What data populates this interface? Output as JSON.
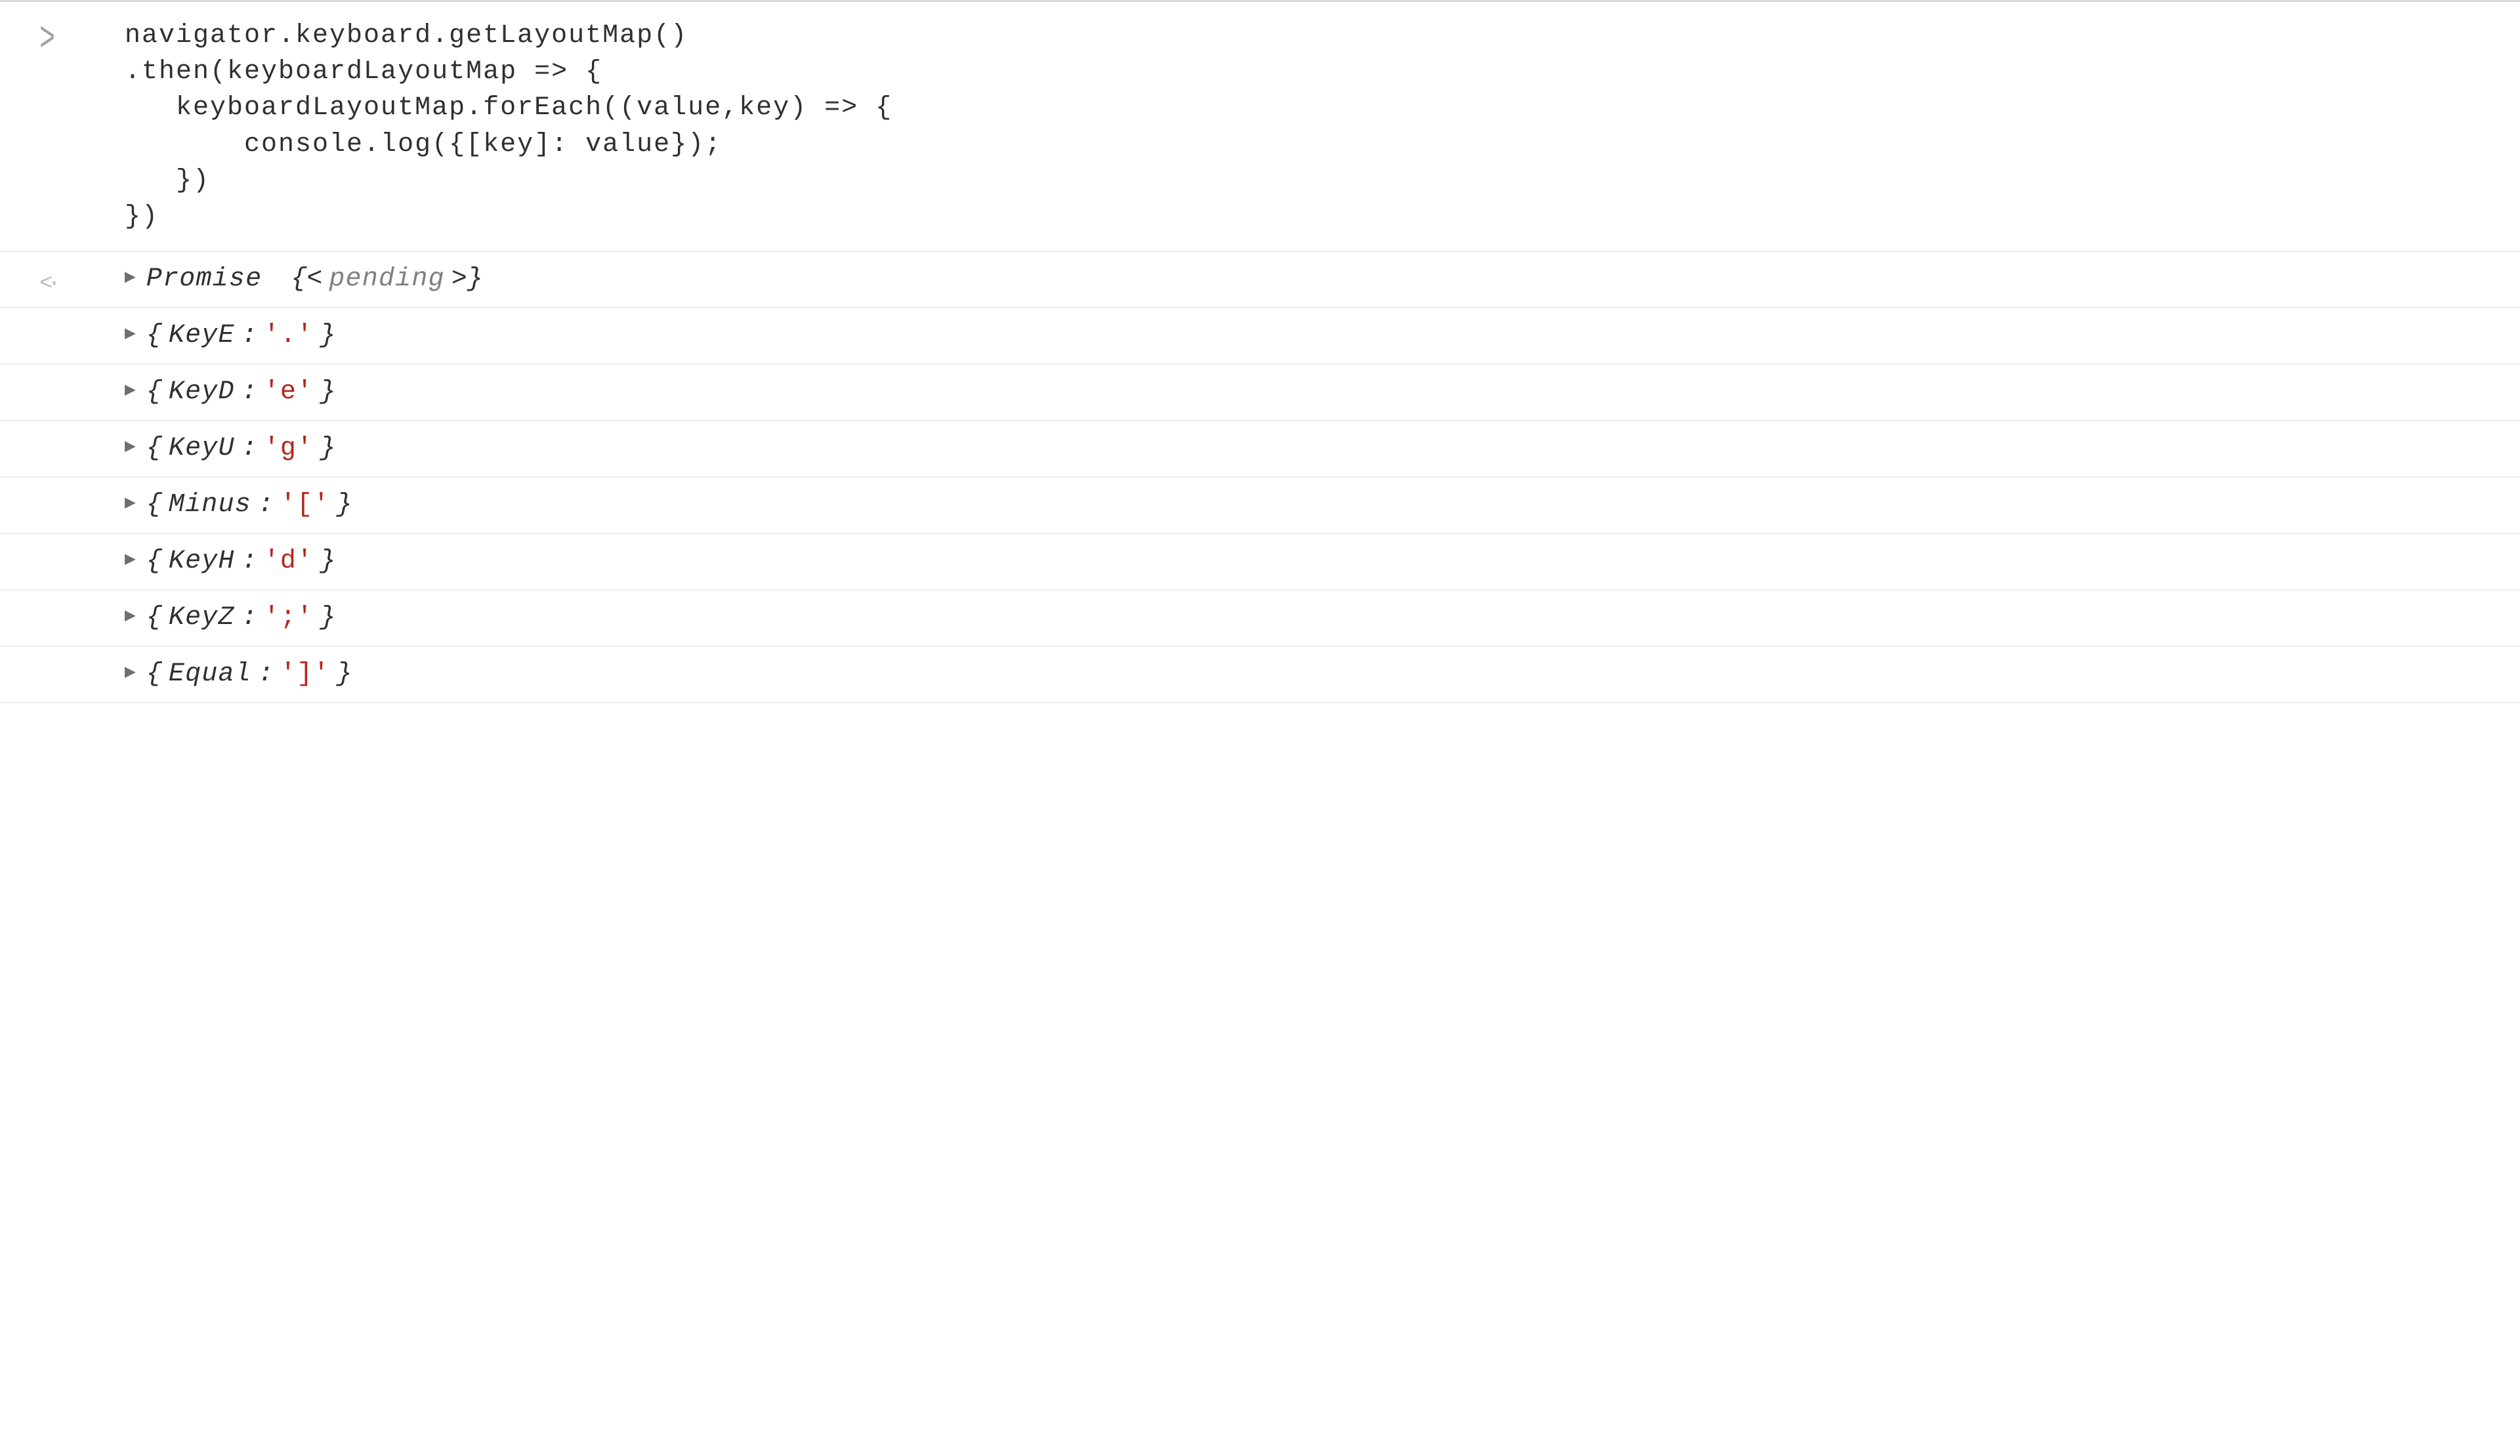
{
  "input": {
    "code": "navigator.keyboard.getLayoutMap()\n.then(keyboardLayoutMap => {\n   keyboardLayoutMap.forEach((value,key) => {\n       console.log({[key]: value});\n   })\n})",
    "prompt": ">"
  },
  "result": {
    "marker": "<·",
    "promise_label": "Promise",
    "pending_open": "{<",
    "pending_word": "pending",
    "pending_close": ">}"
  },
  "logs": [
    {
      "key": "KeyE",
      "value": "'.'"
    },
    {
      "key": "KeyD",
      "value": "'e'"
    },
    {
      "key": "KeyU",
      "value": "'g'"
    },
    {
      "key": "Minus",
      "value": "'['"
    },
    {
      "key": "KeyH",
      "value": "'d'"
    },
    {
      "key": "KeyZ",
      "value": "';'"
    },
    {
      "key": "Equal",
      "value": "']'"
    }
  ],
  "glyphs": {
    "triangle": "▶",
    "brace_open": "{",
    "brace_close": "}",
    "colon_sp": ": "
  }
}
